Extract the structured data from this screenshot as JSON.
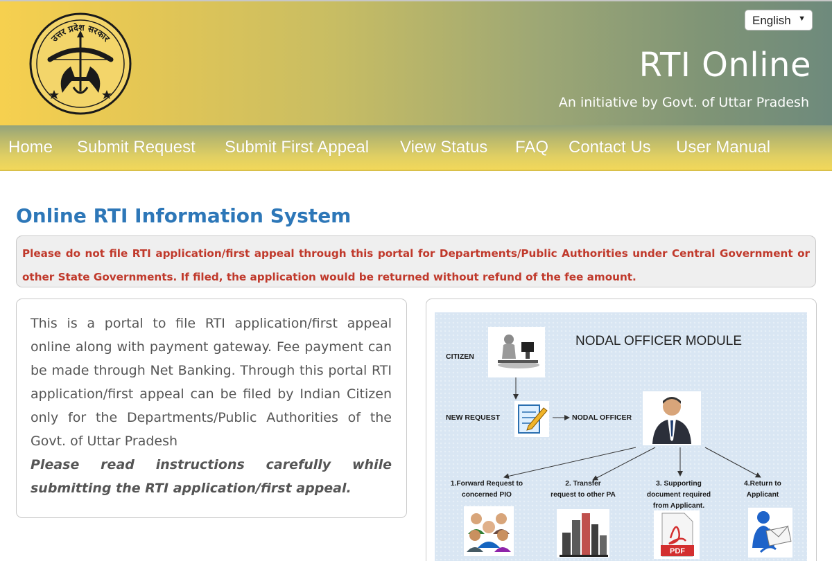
{
  "header": {
    "emblem_text": "उत्तर प्रदेश सरकार",
    "language": "English",
    "title": "RTI Online",
    "subtitle": "An initiative by Govt. of Uttar Pradesh"
  },
  "nav": {
    "items": [
      {
        "label": "Home"
      },
      {
        "label": "Submit Request"
      },
      {
        "label": "Submit First Appeal"
      },
      {
        "label": "View Status"
      },
      {
        "label": "FAQ"
      },
      {
        "label": "Contact Us"
      },
      {
        "label": "User Manual"
      }
    ]
  },
  "main": {
    "title": "Online RTI Information System",
    "notice": "Please do not file RTI application/first appeal through this portal for Departments/Public Authorities under Central Government or other State Governments. If filed, the application would be returned without refund of the fee amount.",
    "info_text": "This is a portal to file RTI application/first appeal online along with payment gateway. Fee payment can be made through Net Banking. Through this portal RTI application/first appeal can be filed by Indian Citizen only for the Departments/Public Authorities of the Govt. of Uttar Pradesh",
    "info_note": "Please read instructions carefully while submitting the RTI application/first appeal."
  },
  "diagram": {
    "title": "NODAL OFFICER MODULE",
    "citizen": "CITIZEN",
    "new_request": "NEW  REQUEST",
    "nodal_officer": "NODAL  OFFICER",
    "steps": [
      {
        "line1": "1.Forward Request to",
        "line2": "concerned PIO",
        "line3": ""
      },
      {
        "line1": "2. Transfer",
        "line2": "request to other PA",
        "line3": ""
      },
      {
        "line1": "3. Supporting",
        "line2": "document  required",
        "line3": "from Applicant."
      },
      {
        "line1": "4.Return to",
        "line2": "Applicant",
        "line3": ""
      }
    ],
    "pdf_label": "PDF"
  }
}
